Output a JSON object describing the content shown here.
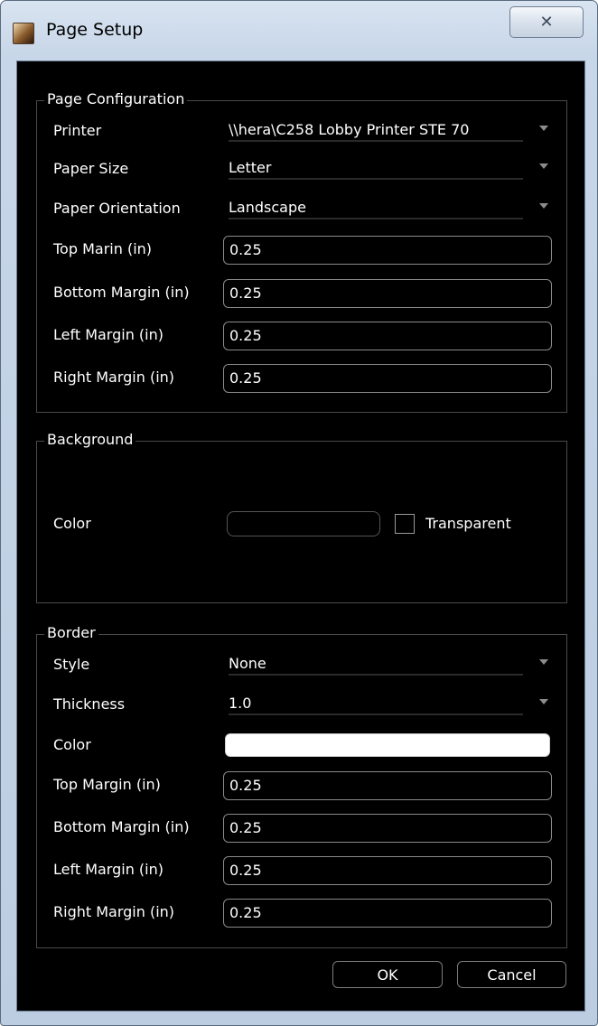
{
  "window": {
    "title": "Page Setup",
    "close_glyph": "✕",
    "app_icon": "app-icon"
  },
  "page_configuration": {
    "title": "Page Configuration",
    "printer": {
      "label": "Printer",
      "value": "\\\\hera\\C258 Lobby Printer STE 70"
    },
    "paper_size": {
      "label": "Paper Size",
      "value": "Letter"
    },
    "paper_orientation": {
      "label": "Paper Orientation",
      "value": "Landscape"
    },
    "top_margin": {
      "label": "Top Marin (in)",
      "value": "0.25"
    },
    "bottom_margin": {
      "label": "Bottom Margin (in)",
      "value": "0.25"
    },
    "left_margin": {
      "label": "Left Margin (in)",
      "value": "0.25"
    },
    "right_margin": {
      "label": "Right Margin (in)",
      "value": "0.25"
    }
  },
  "background": {
    "title": "Background",
    "color_label": "Color",
    "transparent_label": "Transparent",
    "transparent_checked": false
  },
  "border": {
    "title": "Border",
    "style": {
      "label": "Style",
      "value": "None"
    },
    "thickness": {
      "label": "Thickness",
      "value": "1.0"
    },
    "color": {
      "label": "Color",
      "value": "#ffffff"
    },
    "top_margin": {
      "label": "Top Margin (in)",
      "value": "0.25"
    },
    "bottom_margin": {
      "label": "Bottom Margin (in)",
      "value": "0.25"
    },
    "left_margin": {
      "label": "Left Margin (in)",
      "value": "0.25"
    },
    "right_margin": {
      "label": "Right Margin (in)",
      "value": "0.25"
    }
  },
  "buttons": {
    "ok": "OK",
    "cancel": "Cancel"
  }
}
